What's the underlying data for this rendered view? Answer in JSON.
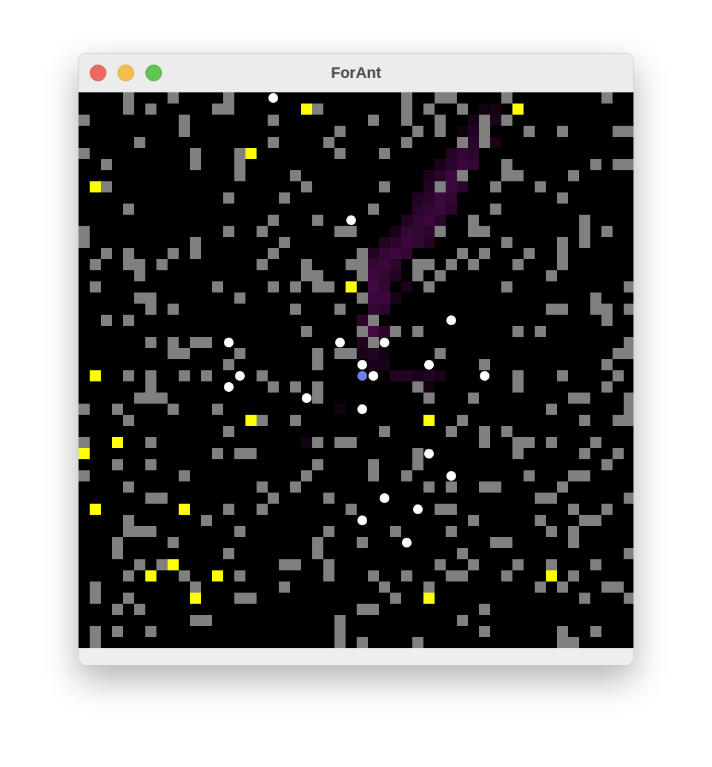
{
  "window": {
    "title": "ForAnt"
  },
  "world": {
    "columns": 50,
    "rows": 50,
    "nest": [
      25,
      25
    ],
    "obstacles": [
      [
        4,
        8,
        13,
        29,
        32,
        33,
        38,
        47
      ],
      [
        4,
        6,
        12,
        13,
        21,
        29,
        31,
        34
      ],
      [
        0,
        9,
        17,
        26,
        29,
        32,
        36,
        38
      ],
      [
        9,
        23,
        30,
        32,
        36,
        40,
        43,
        48,
        49
      ],
      [
        5,
        17,
        22,
        29,
        34,
        36
      ],
      [
        0,
        10,
        14,
        23,
        27
      ],
      [
        2,
        10,
        14,
        38,
        46,
        48,
        49
      ],
      [
        14,
        19,
        34,
        38,
        39,
        44
      ],
      [
        2,
        20,
        27,
        32,
        37,
        41
      ],
      [
        13,
        18,
        43
      ],
      [
        4,
        26,
        37
      ],
      [
        17,
        21,
        35,
        45
      ],
      [
        0,
        13,
        16,
        23,
        24,
        32,
        35,
        36,
        45,
        47
      ],
      [
        0,
        10,
        18,
        38,
        43,
        45
      ],
      [
        2,
        4,
        8,
        10,
        17,
        25,
        34,
        36,
        40,
        43
      ],
      [
        1,
        4,
        5,
        7,
        16,
        20,
        24,
        25,
        30,
        31,
        33,
        35,
        39,
        43
      ],
      [
        5,
        20,
        21,
        25,
        30,
        32,
        42
      ],
      [
        1,
        12,
        17,
        19,
        21,
        22,
        31,
        38,
        49
      ],
      [
        5,
        6,
        14,
        25,
        46
      ],
      [
        6,
        8,
        19,
        23,
        42,
        43,
        46,
        47,
        49
      ],
      [
        2,
        4,
        26,
        47
      ],
      [
        20,
        25,
        28,
        30,
        39,
        41
      ],
      [
        6,
        8,
        10,
        11,
        26,
        49
      ],
      [
        8,
        9,
        14,
        21,
        23,
        24,
        32,
        48,
        49
      ],
      [
        13,
        21,
        36,
        47
      ],
      [
        4,
        6,
        9,
        11,
        16,
        39,
        43,
        48
      ],
      [
        6,
        17,
        19,
        21,
        30,
        39,
        47
      ],
      [
        5,
        6,
        7,
        21,
        31,
        35,
        44,
        45,
        49
      ],
      [
        0,
        3,
        8,
        12,
        42,
        49
      ],
      [
        4,
        16,
        19,
        34,
        45,
        48,
        49
      ],
      [
        13,
        27,
        33,
        36,
        38
      ],
      [
        0,
        6,
        21,
        23,
        24,
        36,
        39,
        40,
        42,
        46
      ],
      [
        12,
        14,
        15,
        30,
        39,
        45,
        48
      ],
      [
        3,
        6,
        21,
        26,
        30,
        47
      ],
      [
        0,
        9,
        20,
        26,
        29,
        40,
        44,
        45
      ],
      [
        4,
        16,
        19,
        31,
        33,
        36,
        37,
        43
      ],
      [
        6,
        7,
        17,
        22,
        41,
        42,
        49
      ],
      [
        13,
        16,
        24,
        32,
        33,
        44,
        47
      ],
      [
        4,
        11,
        35,
        41,
        45,
        46
      ],
      [
        4,
        5,
        6,
        14,
        22,
        28,
        33,
        42,
        44
      ],
      [
        3,
        8,
        21,
        25,
        37,
        38,
        44
      ],
      [
        3,
        13,
        21,
        34,
        49
      ],
      [
        5,
        7,
        18,
        19,
        22,
        32,
        35,
        39,
        42,
        46
      ],
      [
        4,
        9,
        14,
        22,
        26,
        29,
        33,
        34,
        38,
        44
      ],
      [
        1,
        10,
        18,
        27,
        31,
        41,
        43,
        47,
        48
      ],
      [
        1,
        4,
        14,
        15,
        28,
        45,
        49
      ],
      [
        3,
        5,
        25,
        26,
        36
      ],
      [
        10,
        11,
        23,
        34
      ],
      [
        1,
        3,
        6,
        23,
        36,
        43,
        46
      ],
      [
        1,
        23,
        25,
        30,
        43,
        44
      ]
    ],
    "food": [
      [
        20,
        1
      ],
      [
        39,
        1
      ],
      [
        15,
        5
      ],
      [
        1,
        8
      ],
      [
        24,
        17
      ],
      [
        1,
        25
      ],
      [
        15,
        29
      ],
      [
        31,
        29
      ],
      [
        3,
        31
      ],
      [
        0,
        32
      ],
      [
        1,
        37
      ],
      [
        9,
        37
      ],
      [
        8,
        42
      ],
      [
        6,
        43
      ],
      [
        12,
        43
      ],
      [
        42,
        43
      ],
      [
        10,
        45
      ],
      [
        31,
        45
      ]
    ],
    "ants": [
      [
        17,
        0
      ],
      [
        24,
        11
      ],
      [
        33,
        20
      ],
      [
        13,
        22
      ],
      [
        23,
        22
      ],
      [
        27,
        22
      ],
      [
        25,
        24
      ],
      [
        31,
        24
      ],
      [
        14,
        25
      ],
      [
        26,
        25
      ],
      [
        36,
        25
      ],
      [
        13,
        26
      ],
      [
        20,
        27
      ],
      [
        25,
        28
      ],
      [
        31,
        32
      ],
      [
        33,
        34
      ],
      [
        27,
        36
      ],
      [
        30,
        37
      ],
      [
        25,
        38
      ],
      [
        29,
        40
      ]
    ],
    "pheromone": [
      [
        36,
        1,
        0.2
      ],
      [
        37,
        1,
        0.25
      ],
      [
        35,
        2,
        0.3
      ],
      [
        36,
        2,
        0.4
      ],
      [
        37,
        2,
        0.3
      ],
      [
        34,
        3,
        0.2
      ],
      [
        35,
        3,
        0.4
      ],
      [
        36,
        3,
        0.5
      ],
      [
        34,
        4,
        0.4
      ],
      [
        35,
        4,
        0.5
      ],
      [
        37,
        4,
        0.3
      ],
      [
        33,
        5,
        0.4
      ],
      [
        34,
        5,
        0.6
      ],
      [
        35,
        5,
        0.5
      ],
      [
        32,
        6,
        0.3
      ],
      [
        33,
        6,
        0.5
      ],
      [
        34,
        6,
        0.7
      ],
      [
        35,
        6,
        0.6
      ],
      [
        31,
        7,
        0.3
      ],
      [
        32,
        7,
        0.5
      ],
      [
        33,
        7,
        0.7
      ],
      [
        34,
        7,
        0.6
      ],
      [
        31,
        8,
        0.4
      ],
      [
        33,
        8,
        0.7
      ],
      [
        34,
        8,
        0.5
      ],
      [
        30,
        9,
        0.4
      ],
      [
        31,
        9,
        0.5
      ],
      [
        32,
        9,
        0.7
      ],
      [
        33,
        9,
        0.6
      ],
      [
        30,
        10,
        0.5
      ],
      [
        31,
        10,
        0.6
      ],
      [
        32,
        10,
        0.7
      ],
      [
        33,
        10,
        0.5
      ],
      [
        29,
        11,
        0.4
      ],
      [
        30,
        11,
        0.6
      ],
      [
        31,
        11,
        0.7
      ],
      [
        32,
        11,
        0.5
      ],
      [
        28,
        12,
        0.3
      ],
      [
        29,
        12,
        0.6
      ],
      [
        30,
        12,
        0.6
      ],
      [
        31,
        12,
        0.5
      ],
      [
        27,
        13,
        0.4
      ],
      [
        28,
        13,
        0.5
      ],
      [
        29,
        13,
        0.7
      ],
      [
        30,
        13,
        0.6
      ],
      [
        31,
        13,
        0.4
      ],
      [
        26,
        14,
        0.4
      ],
      [
        27,
        14,
        0.6
      ],
      [
        28,
        14,
        0.7
      ],
      [
        29,
        14,
        0.6
      ],
      [
        26,
        15,
        0.6
      ],
      [
        27,
        15,
        0.7
      ],
      [
        28,
        15,
        0.5
      ],
      [
        26,
        16,
        0.7
      ],
      [
        27,
        16,
        0.6
      ],
      [
        28,
        16,
        0.4
      ],
      [
        26,
        17,
        0.8
      ],
      [
        27,
        17,
        0.6
      ],
      [
        29,
        17,
        0.3
      ],
      [
        26,
        18,
        0.7
      ],
      [
        27,
        18,
        0.7
      ],
      [
        28,
        18,
        0.3
      ],
      [
        26,
        19,
        0.6
      ],
      [
        27,
        19,
        0.5
      ],
      [
        25,
        20,
        0.5
      ],
      [
        26,
        20,
        0.6
      ],
      [
        26,
        21,
        0.8
      ],
      [
        27,
        21,
        0.5
      ],
      [
        25,
        22,
        0.4
      ],
      [
        26,
        22,
        0.5
      ],
      [
        25,
        23,
        0.3
      ],
      [
        26,
        23,
        0.4
      ],
      [
        27,
        23,
        0.2
      ],
      [
        26,
        24,
        0.3
      ],
      [
        27,
        24,
        0.3
      ],
      [
        28,
        25,
        0.4
      ],
      [
        29,
        25,
        0.4
      ],
      [
        30,
        25,
        0.3
      ],
      [
        31,
        25,
        0.4
      ],
      [
        32,
        25,
        0.3
      ],
      [
        31,
        26,
        0.2
      ],
      [
        23,
        28,
        0.2
      ],
      [
        20,
        31,
        0.2
      ]
    ]
  }
}
